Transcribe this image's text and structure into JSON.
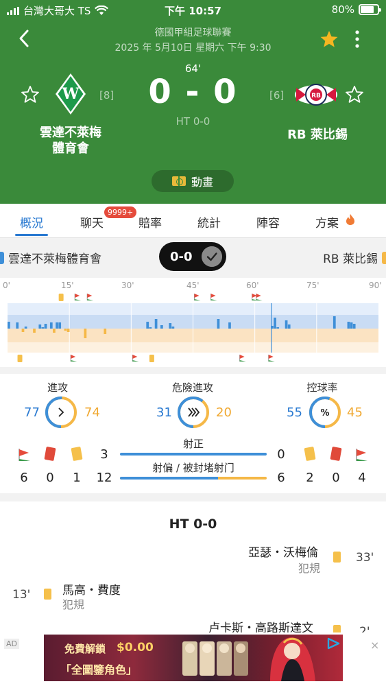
{
  "status_bar": {
    "carrier": "台灣大哥大 TS",
    "time": "下午 10:57",
    "battery": "80%"
  },
  "header": {
    "league": "德國甲組足球聯賽",
    "datetime": "2025 年 5月10日 星期六 下午 9:30",
    "minute": "64'",
    "score": "0 - 0",
    "half_time": "HT 0-0",
    "home": {
      "name_line1": "雲達不萊梅",
      "name_line2": "體育會",
      "rank": "[8]"
    },
    "away": {
      "name": "RB 萊比錫",
      "rank": "[6]"
    },
    "animation_button": "動畫"
  },
  "tabs": {
    "items": [
      {
        "label": "概況"
      },
      {
        "label": "聊天"
      },
      {
        "label": "賠率"
      },
      {
        "label": "統計"
      },
      {
        "label": "陣容"
      },
      {
        "label": "方案"
      }
    ],
    "chat_badge": "9999+",
    "active": "概況"
  },
  "team_bar": {
    "home": "雲達不萊梅體育會",
    "away": "RB 萊比錫",
    "score": "0-0"
  },
  "timeline": {
    "ticks": [
      "0'",
      "15'",
      "30'",
      "45'",
      "60'",
      "75'",
      "90'"
    ],
    "current_minute": 64,
    "home_bars": [
      10,
      0,
      0,
      9,
      0,
      0,
      3,
      0,
      0,
      0,
      0,
      6,
      2,
      7,
      0,
      9,
      0,
      9,
      9,
      0,
      0,
      0,
      0,
      0,
      0,
      0,
      0,
      0,
      0,
      0,
      0,
      0,
      0,
      0,
      0,
      0,
      0,
      0,
      0,
      0,
      0,
      0,
      0,
      0,
      0,
      0,
      0,
      0,
      0,
      10,
      2,
      0,
      14,
      0,
      5,
      0,
      0,
      8,
      3,
      0,
      0,
      0,
      0,
      0,
      0,
      0,
      0,
      0,
      0,
      0,
      0,
      0,
      0,
      0,
      14,
      0,
      0,
      0,
      9,
      0,
      0,
      0,
      0,
      0,
      0,
      0,
      0,
      0,
      0,
      0,
      0,
      0,
      0,
      4,
      16,
      2,
      0,
      0,
      12,
      6,
      0,
      0,
      0,
      0,
      0,
      0,
      0,
      0,
      0,
      0,
      0,
      0,
      0,
      0,
      0,
      18,
      0,
      0,
      0,
      0,
      10,
      9,
      7,
      0,
      0,
      0,
      0,
      0,
      0,
      0,
      0
    ],
    "away_bars": [
      0,
      0,
      0,
      0,
      0,
      5,
      0,
      0,
      0,
      6,
      0,
      0,
      0,
      0,
      0,
      0,
      6,
      0,
      0,
      0,
      3,
      5,
      0,
      0,
      0,
      0,
      0,
      14,
      0,
      0,
      0,
      0,
      0,
      0,
      8,
      0,
      0,
      0,
      0,
      0,
      0,
      0,
      0,
      0,
      0,
      0,
      0,
      0,
      0,
      0,
      0,
      0,
      0,
      0,
      0,
      0,
      0,
      0,
      0,
      0,
      0,
      0,
      0,
      0,
      0,
      0,
      0,
      0,
      0,
      0,
      0,
      0,
      0,
      0,
      0,
      0,
      0,
      0,
      0,
      0,
      0,
      0,
      0,
      0,
      0,
      0,
      0,
      0,
      0,
      0,
      0,
      0,
      0,
      0,
      0,
      0,
      0,
      0,
      0,
      0,
      0,
      0,
      0,
      0,
      0,
      0,
      0,
      0,
      0,
      0,
      0,
      0,
      0,
      0,
      0,
      0,
      0,
      0,
      0,
      0,
      0,
      0,
      0,
      0,
      0,
      0,
      0,
      0,
      0,
      0,
      0
    ],
    "home_events": [
      {
        "minute": 13,
        "type": "yellow-card"
      },
      {
        "minute": 17,
        "type": "corner"
      },
      {
        "minute": 20,
        "type": "corner"
      },
      {
        "minute": 46,
        "type": "corner"
      },
      {
        "minute": 50,
        "type": "corner"
      },
      {
        "minute": 60,
        "type": "corner"
      },
      {
        "minute": 61,
        "type": "corner"
      }
    ],
    "away_events": [
      {
        "minute": 3,
        "type": "yellow-card"
      },
      {
        "minute": 16,
        "type": "corner"
      },
      {
        "minute": 31,
        "type": "corner"
      },
      {
        "minute": 35,
        "type": "yellow-card"
      },
      {
        "minute": 57,
        "type": "corner"
      },
      {
        "minute": 64,
        "type": "corner"
      }
    ]
  },
  "stats": {
    "attack": {
      "title": "進攻",
      "home": "77",
      "away": "74",
      "home_value": 77,
      "away_value": 74
    },
    "dangerous_attack": {
      "title": "危險進攻",
      "home": "31",
      "away": "20",
      "home_value": 31,
      "away_value": 20
    },
    "possession": {
      "title": "控球率",
      "home": "55",
      "away": "45",
      "home_value": 55,
      "away_value": 45
    },
    "home_counts": {
      "corners": "6",
      "red_cards": "0",
      "yellow_cards": "1"
    },
    "away_counts": {
      "yellow_cards": "2",
      "red_cards": "0",
      "corners": "4"
    },
    "on_target": {
      "title": "射正",
      "home": "3",
      "away": "0",
      "home_value": 3,
      "away_value": 0
    },
    "off_target": {
      "title": "射偏 / 被封堵射门",
      "home": "12",
      "away": "6",
      "home_value": 12,
      "away_value": 6
    }
  },
  "events": {
    "ht_label": "HT 0-0",
    "items": [
      {
        "side": "away",
        "player": "亞瑟・沃梅倫",
        "detail": "犯規",
        "minute": "33'"
      },
      {
        "side": "home",
        "player": "馬高・費度",
        "detail": "犯規",
        "minute": "13'"
      },
      {
        "side": "away",
        "player": "卢卡斯・高路斯達文",
        "detail": "",
        "minute": "2'"
      }
    ]
  },
  "ad": {
    "tag": "AD",
    "line1": "免費解鎖",
    "line2": "$0.00",
    "line3": "「全圖鑒角色」",
    "close": "×"
  },
  "colors": {
    "header_green": "#3a8a3a",
    "home_blue": "#3e8fd8",
    "away_orange": "#f5b847",
    "tab_active": "#2a7ad1",
    "badge_red": "#e54b3c"
  }
}
